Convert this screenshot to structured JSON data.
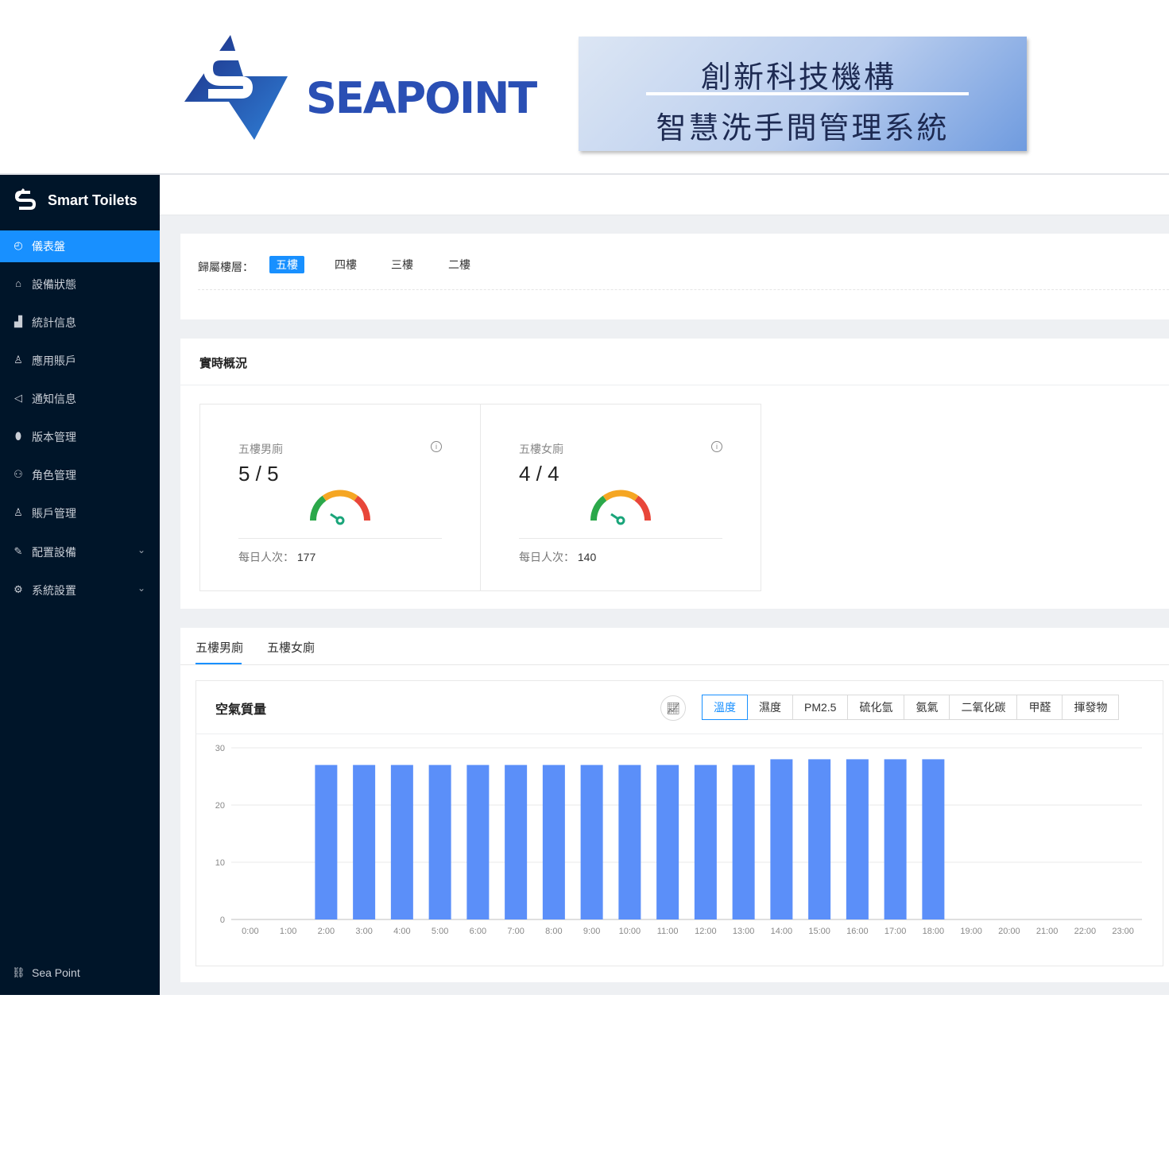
{
  "banner": {
    "brand_name": "SEAPOINT",
    "title_line1": "創新科技機構",
    "title_line2": "智慧洗手間管理系統"
  },
  "sidebar": {
    "app_title": "Smart Toilets",
    "items": [
      {
        "label": "儀表盤",
        "icon": "dashboard-icon",
        "active": true
      },
      {
        "label": "設備狀態",
        "icon": "device-icon"
      },
      {
        "label": "統計信息",
        "icon": "bar-chart-icon"
      },
      {
        "label": "應用賬戶",
        "icon": "user-icon"
      },
      {
        "label": "通知信息",
        "icon": "megaphone-icon"
      },
      {
        "label": "版本管理",
        "icon": "version-icon"
      },
      {
        "label": "角色管理",
        "icon": "team-icon"
      },
      {
        "label": "賬戶管理",
        "icon": "user-icon"
      },
      {
        "label": "配置設備",
        "icon": "edit-icon",
        "expandable": true
      },
      {
        "label": "系統設置",
        "icon": "gear-icon",
        "expandable": true
      }
    ],
    "footer_label": "Sea Point"
  },
  "floor_filter": {
    "label": "歸屬樓層：",
    "floors": [
      "五樓",
      "四樓",
      "三樓",
      "二樓"
    ],
    "selected": "五樓"
  },
  "realtime": {
    "title": "實時概況",
    "cards": [
      {
        "name": "五樓男廁",
        "value": "5 / 5",
        "daily_label": "每日人次：",
        "daily_value": "177"
      },
      {
        "name": "五樓女廁",
        "value": "4 / 4",
        "daily_label": "每日人次：",
        "daily_value": "140"
      }
    ]
  },
  "location_tabs": {
    "tabs": [
      "五樓男廁",
      "五樓女廁"
    ],
    "selected": "五樓男廁"
  },
  "air_quality": {
    "title": "空氣質量",
    "chart_toggle_icon": "line-chart-icon",
    "metrics": [
      "溫度",
      "濕度",
      "PM2.5",
      "硫化氫",
      "氨氣",
      "二氧化碳",
      "甲醛",
      "揮發物"
    ],
    "selected_metric": "溫度"
  },
  "colors": {
    "sidebar_bg": "#001529",
    "accent": "#1890ff",
    "bar": "#5b8ff9",
    "gauge_green": "#2ba84a",
    "gauge_yellow": "#f5a623",
    "gauge_red": "#e8463a"
  },
  "chart_data": {
    "type": "bar",
    "categories": [
      "0:00",
      "1:00",
      "2:00",
      "3:00",
      "4:00",
      "5:00",
      "6:00",
      "7:00",
      "8:00",
      "9:00",
      "10:00",
      "11:00",
      "12:00",
      "13:00",
      "14:00",
      "15:00",
      "16:00",
      "17:00",
      "18:00",
      "19:00",
      "20:00",
      "21:00",
      "22:00",
      "23:00"
    ],
    "values": [
      0,
      0,
      27,
      27,
      27,
      27,
      27,
      27,
      27,
      27,
      27,
      27,
      27,
      27,
      28,
      28,
      28,
      28,
      28,
      0,
      0,
      0,
      0,
      0
    ],
    "ylim": [
      0,
      30
    ],
    "yticks": [
      0,
      10,
      20,
      30
    ],
    "grid": true,
    "title": "",
    "xlabel": "",
    "ylabel": ""
  }
}
